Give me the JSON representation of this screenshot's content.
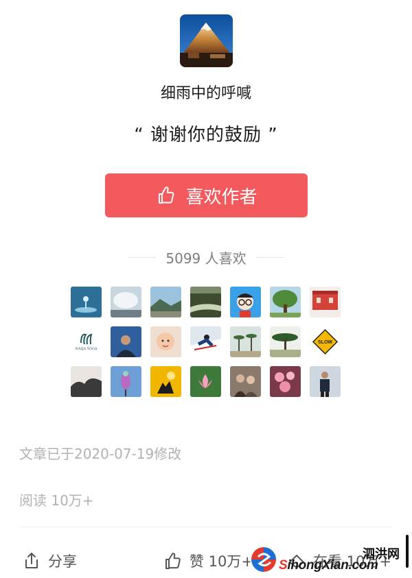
{
  "author": {
    "name": "细雨中的呼喊",
    "avatar_icon": "mountain-avatar-icon"
  },
  "quote": "“ 谢谢你的鼓励 ”",
  "like_button": {
    "label": "喜欢作者",
    "icon": "thumbs-up-icon",
    "color": "#f25a5d"
  },
  "likes_summary": {
    "count_text": "5099 人喜欢"
  },
  "supporters": [
    {
      "icon": "water-drop-avatar"
    },
    {
      "icon": "cloud-sky-avatar"
    },
    {
      "icon": "landscape-avatar"
    },
    {
      "icon": "river-avatar"
    },
    {
      "icon": "cartoon-glasses-avatar"
    },
    {
      "icon": "tree-avatar"
    },
    {
      "icon": "red-building-avatar"
    },
    {
      "icon": "yoga-logo-avatar",
      "text": "NAIJA YOGA"
    },
    {
      "icon": "person-avatar"
    },
    {
      "icon": "baby-avatar"
    },
    {
      "icon": "skier-avatar"
    },
    {
      "icon": "palm-trees-avatar"
    },
    {
      "icon": "acacia-tree-avatar"
    },
    {
      "icon": "slow-sign-avatar",
      "text": "SLOW"
    },
    {
      "icon": "dark-scene-avatar"
    },
    {
      "icon": "bird-avatar"
    },
    {
      "icon": "sunset-silhouette-avatar"
    },
    {
      "icon": "lotus-avatar"
    },
    {
      "icon": "couple-avatar"
    },
    {
      "icon": "peach-blossom-avatar"
    },
    {
      "icon": "man-standing-avatar"
    }
  ],
  "meta": {
    "modified": "文章已于2020-07-19修改",
    "reads": "阅读 10万+"
  },
  "actions": {
    "share": {
      "label": "分享",
      "icon": "share-icon"
    },
    "like": {
      "label": "赞 10万+",
      "icon": "thumbs-up-outline-icon"
    },
    "look": {
      "label": "在看 10万+",
      "icon": "look-icon"
    }
  },
  "watermark": {
    "cn": "泗洪网",
    "url_prefix": "S",
    "url_rest": "ihongXian.com"
  }
}
